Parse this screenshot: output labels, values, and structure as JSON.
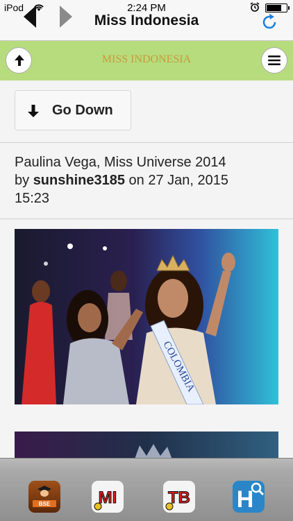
{
  "status_bar": {
    "carrier": "iPod",
    "time": "2:24 PM",
    "wifi_icon": "wifi-icon",
    "alarm_icon": "alarm-icon",
    "battery_level": 0.75
  },
  "nav_bar": {
    "title": "Miss Indonesia",
    "back_icon": "back-arrow-icon",
    "forward_icon": "forward-arrow-icon",
    "reload_icon": "reload-icon"
  },
  "header": {
    "logo_text": "MISS INDONESIA",
    "up_icon": "arrow-up-icon",
    "menu_icon": "hamburger-menu-icon",
    "background_color": "#b7dc7d"
  },
  "content": {
    "go_down_label": "Go Down",
    "post": {
      "title": "Paulina Vega, Miss Universe 2014",
      "by_text": "by",
      "author": "sunshine3185",
      "on_text": "on 27 Jan, 2015",
      "time": "15:23"
    },
    "photo": {
      "sash_text": "COLOMBIA"
    }
  },
  "app_bar": {
    "apps": [
      {
        "label": "BSE",
        "icon": "bse-app-icon",
        "color": "#7a3a10"
      },
      {
        "label": "MI",
        "icon": "mi-app-icon",
        "color": "#d8201a"
      },
      {
        "label": "TB",
        "icon": "tb-app-icon",
        "color": "#d8201a"
      },
      {
        "label": "H",
        "icon": "h-app-icon",
        "color": "#2a86c8"
      }
    ]
  }
}
